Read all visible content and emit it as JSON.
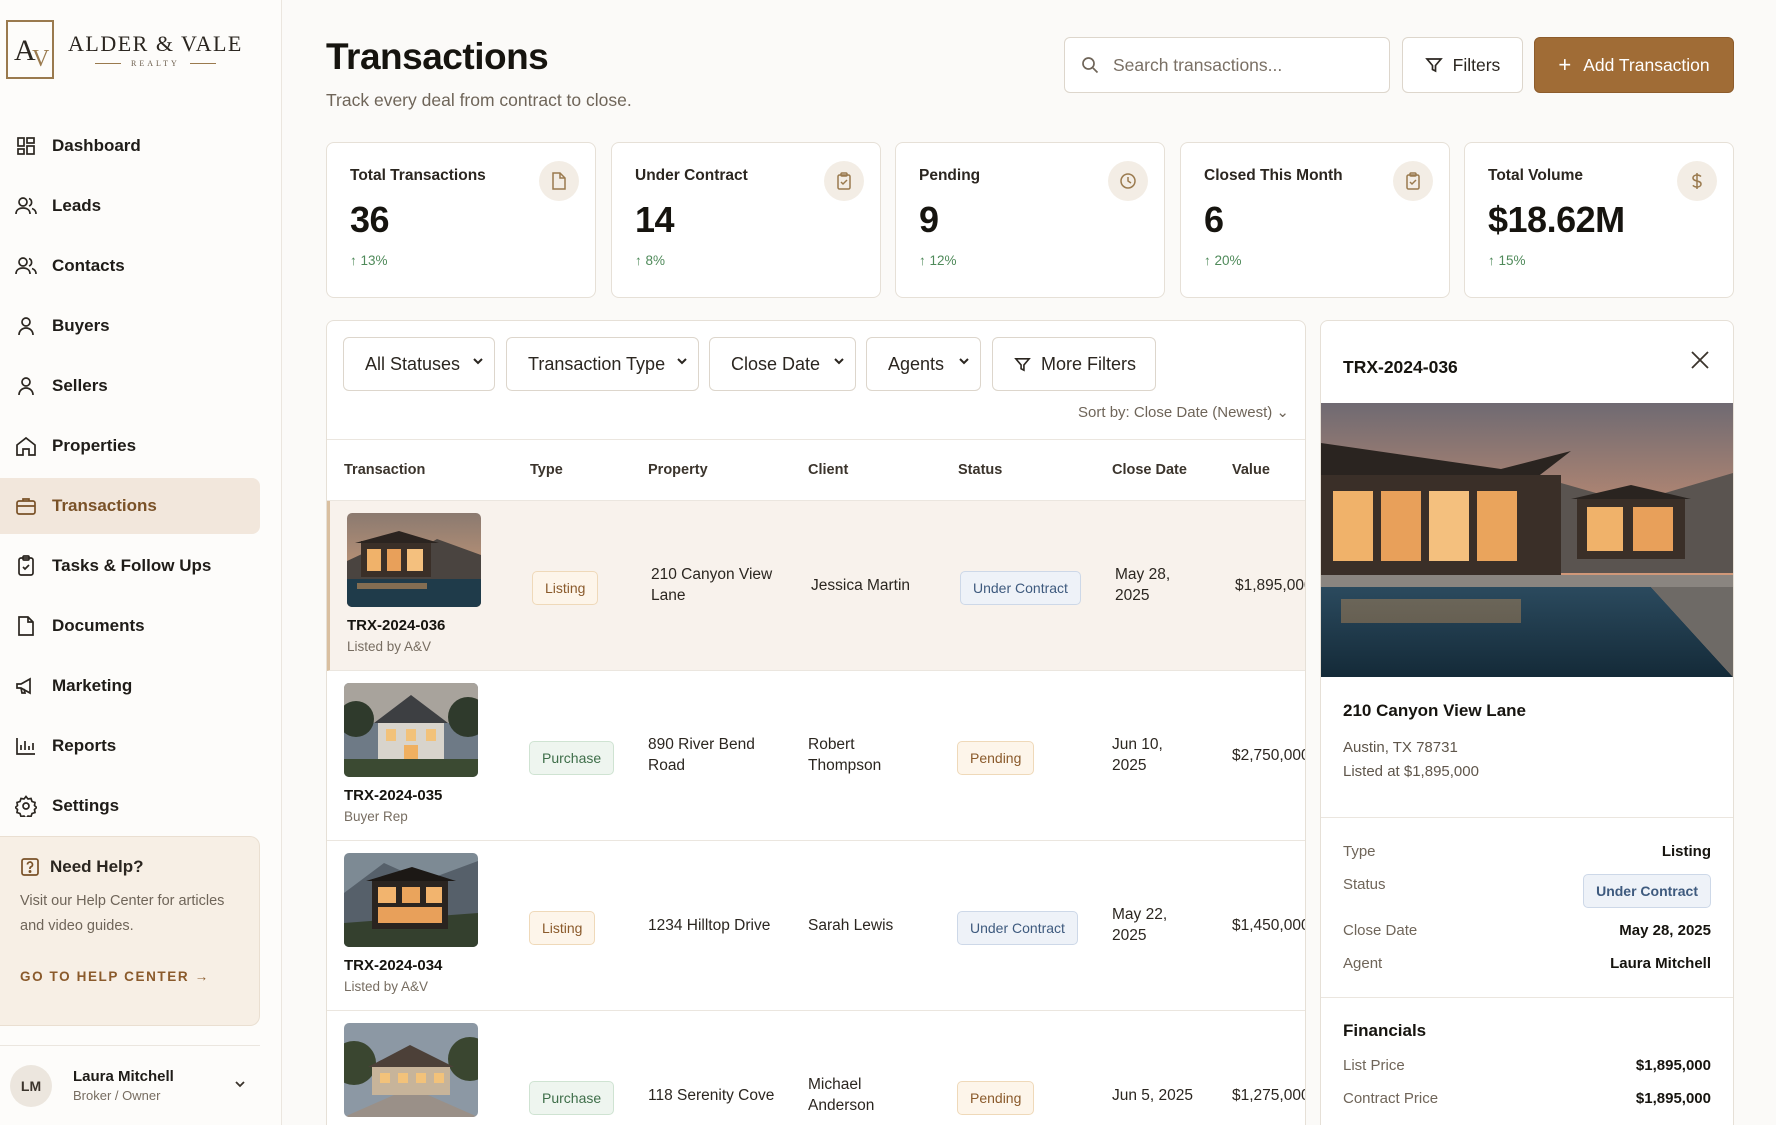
{
  "brand": {
    "name": "ALDER & VALE",
    "sub": "REALTY",
    "mark_a": "A",
    "mark_v": "V"
  },
  "sidebar": {
    "items": [
      {
        "label": "Dashboard",
        "icon": "dashboard-icon"
      },
      {
        "label": "Leads",
        "icon": "users-icon"
      },
      {
        "label": "Contacts",
        "icon": "contacts-icon"
      },
      {
        "label": "Buyers",
        "icon": "person-icon"
      },
      {
        "label": "Sellers",
        "icon": "person-icon"
      },
      {
        "label": "Properties",
        "icon": "home-icon"
      },
      {
        "label": "Transactions",
        "icon": "briefcase-icon",
        "active": true
      },
      {
        "label": "Tasks & Follow Ups",
        "icon": "clipboard-icon"
      },
      {
        "label": "Documents",
        "icon": "document-icon"
      },
      {
        "label": "Marketing",
        "icon": "megaphone-icon"
      },
      {
        "label": "Reports",
        "icon": "bar-chart-icon"
      },
      {
        "label": "Settings",
        "icon": "gear-icon"
      }
    ],
    "help": {
      "title": "Need Help?",
      "body": "Visit our Help Center for articles and video guides.",
      "link": "GO TO HELP CENTER →"
    },
    "user": {
      "initials": "LM",
      "name": "Laura Mitchell",
      "role": "Broker / Owner"
    }
  },
  "header": {
    "title": "Transactions",
    "subtitle": "Track every deal from contract to close.",
    "search_placeholder": "Search transactions...",
    "filters_label": "Filters",
    "add_label": "Add Transaction",
    "add_icon": "+"
  },
  "stats": [
    {
      "label": "Total Transactions",
      "value": "36",
      "trend": "↑ 13%",
      "icon": "document-icon"
    },
    {
      "label": "Under Contract",
      "value": "14",
      "trend": "↑ 8%",
      "icon": "clipboard-icon"
    },
    {
      "label": "Pending",
      "value": "9",
      "trend": "↑ 12%",
      "icon": "clock-icon"
    },
    {
      "label": "Closed This Month",
      "value": "6",
      "trend": "↑ 20%",
      "icon": "clipboard-icon"
    },
    {
      "label": "Total Volume",
      "value": "$18.62M",
      "trend": "↑ 15%",
      "icon": "dollar-icon"
    }
  ],
  "filters": {
    "status": "All Statuses",
    "type": "Transaction Type",
    "close_date": "Close Date",
    "agents": "Agents",
    "more": "More Filters",
    "sort": "Sort by: Close Date (Newest) ⌄"
  },
  "table": {
    "columns": [
      "Transaction",
      "Type",
      "Property",
      "Client",
      "Status",
      "Close Date",
      "Value"
    ],
    "rows": [
      {
        "id": "TRX-2024-036",
        "sub": "Listed by A&V",
        "type": "Listing",
        "property": "210 Canyon View Lane",
        "client": "Jessica Martin",
        "status": "Under Contract",
        "close_date": "May 28, 2025",
        "value": "$1,895,000"
      },
      {
        "id": "TRX-2024-035",
        "sub": "Buyer Rep",
        "type": "Purchase",
        "property": "890 River Bend Road",
        "client": "Robert Thompson",
        "status": "Pending",
        "close_date": "Jun 10, 2025",
        "value": "$2,750,000"
      },
      {
        "id": "TRX-2024-034",
        "sub": "Listed by A&V",
        "type": "Listing",
        "property": "1234 Hilltop Drive",
        "client": "Sarah Lewis",
        "status": "Under Contract",
        "close_date": "May 22, 2025",
        "value": "$1,450,000"
      },
      {
        "id": "",
        "sub": "",
        "type": "Purchase",
        "property": "118 Serenity Cove",
        "client": "Michael Anderson",
        "status": "Pending",
        "close_date": "Jun 5, 2025",
        "value": "$1,275,000"
      }
    ]
  },
  "detail": {
    "title": "TRX-2024-036",
    "address": "210 Canyon View Lane",
    "city": "Austin, TX 78731",
    "listed": "Listed at $1,895,000",
    "type_label": "Type",
    "type_value": "Listing",
    "status_label": "Status",
    "status_value": "Under Contract",
    "close_label": "Close Date",
    "close_value": "May 28, 2025",
    "agent_label": "Agent",
    "agent_value": "Laura Mitchell",
    "financials_title": "Financials",
    "list_price_label": "List Price",
    "list_price_value": "$1,895,000",
    "contract_price_label": "Contract Price",
    "contract_price_value": "$1,895,000"
  },
  "colors": {
    "accent": "#a06c36",
    "active_bg": "#f2e7dc",
    "trend_green": "#4f8a5a"
  }
}
